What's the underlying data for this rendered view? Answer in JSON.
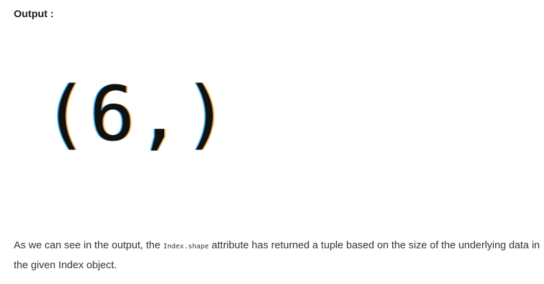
{
  "heading": "Output :",
  "output_text": "(6,)",
  "paragraph": {
    "before": "As we can see in the output, the ",
    "code": "Index.shape",
    "after": " attribute has returned a tuple based on the size of the underlying data in the given Index object."
  }
}
